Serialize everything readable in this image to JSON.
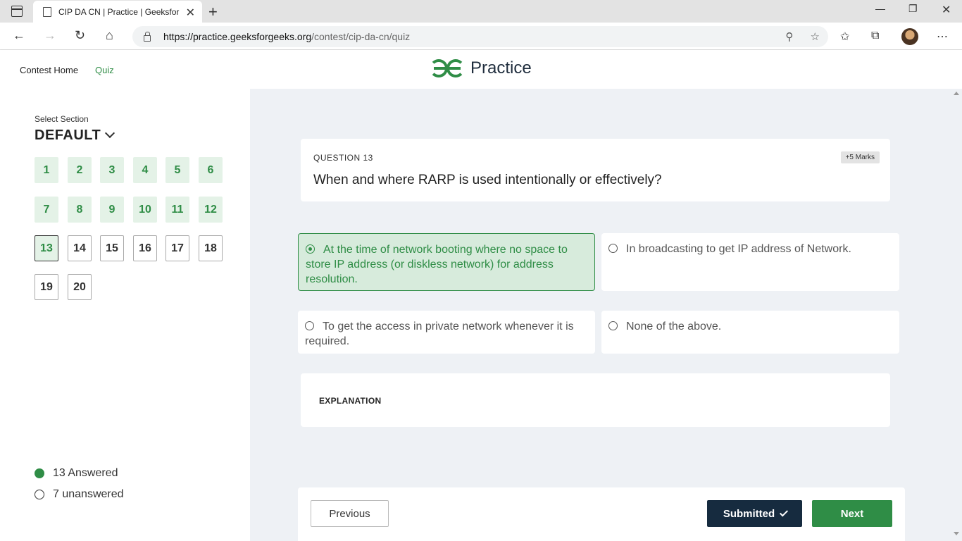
{
  "browser": {
    "tab_title": "CIP DA CN | Practice | GeeksforG",
    "tab_close": "✕",
    "new_tab": "+",
    "url_host": "https://practice.geeksforgeeks.org",
    "url_path": "/contest/cip-da-cn/quiz",
    "icons": [
      "sidebar-toggle-icon",
      "page-icon",
      "back-icon",
      "forward-icon",
      "refresh-icon",
      "home-icon",
      "lock-icon",
      "zoom-icon",
      "add-favorite-icon",
      "favorites-icon",
      "collections-icon",
      "profile-avatar",
      "more-icon",
      "minimize-icon",
      "restore-icon",
      "close-window-icon"
    ]
  },
  "header": {
    "contest_home": "Contest Home",
    "quiz": "Quiz",
    "logo_text": "Practice",
    "accent": "#2f8d46"
  },
  "sidebar": {
    "select_label": "Select Section",
    "section_name": "DEFAULT",
    "questions": [
      {
        "n": "1",
        "state": "answered"
      },
      {
        "n": "2",
        "state": "answered"
      },
      {
        "n": "3",
        "state": "answered"
      },
      {
        "n": "4",
        "state": "answered"
      },
      {
        "n": "5",
        "state": "answered"
      },
      {
        "n": "6",
        "state": "answered"
      },
      {
        "n": "7",
        "state": "answered"
      },
      {
        "n": "8",
        "state": "answered"
      },
      {
        "n": "9",
        "state": "answered"
      },
      {
        "n": "10",
        "state": "answered"
      },
      {
        "n": "11",
        "state": "answered"
      },
      {
        "n": "12",
        "state": "answered"
      },
      {
        "n": "13",
        "state": "current"
      },
      {
        "n": "14",
        "state": "unanswered"
      },
      {
        "n": "15",
        "state": "unanswered"
      },
      {
        "n": "16",
        "state": "unanswered"
      },
      {
        "n": "17",
        "state": "unanswered"
      },
      {
        "n": "18",
        "state": "unanswered"
      },
      {
        "n": "19",
        "state": "unanswered"
      },
      {
        "n": "20",
        "state": "unanswered"
      }
    ],
    "answered_label": "13 Answered",
    "unanswered_label": "7 unanswered"
  },
  "question": {
    "number_label": "QUESTION 13",
    "marks": "+5 Marks",
    "text": "When and where RARP is used intentionally or effectively?",
    "options": [
      {
        "text": "At the time of network booting where no space to store IP address (or diskless network) for address resolution.",
        "selected": true
      },
      {
        "text": "In broadcasting to get IP address of Network.",
        "selected": false
      },
      {
        "text": "To get the access in private network whenever it is required.",
        "selected": false
      },
      {
        "text": "None of the above.",
        "selected": false
      }
    ],
    "explanation_title": "EXPLANATION"
  },
  "footer": {
    "previous": "Previous",
    "submitted": "Submitted",
    "next": "Next"
  }
}
